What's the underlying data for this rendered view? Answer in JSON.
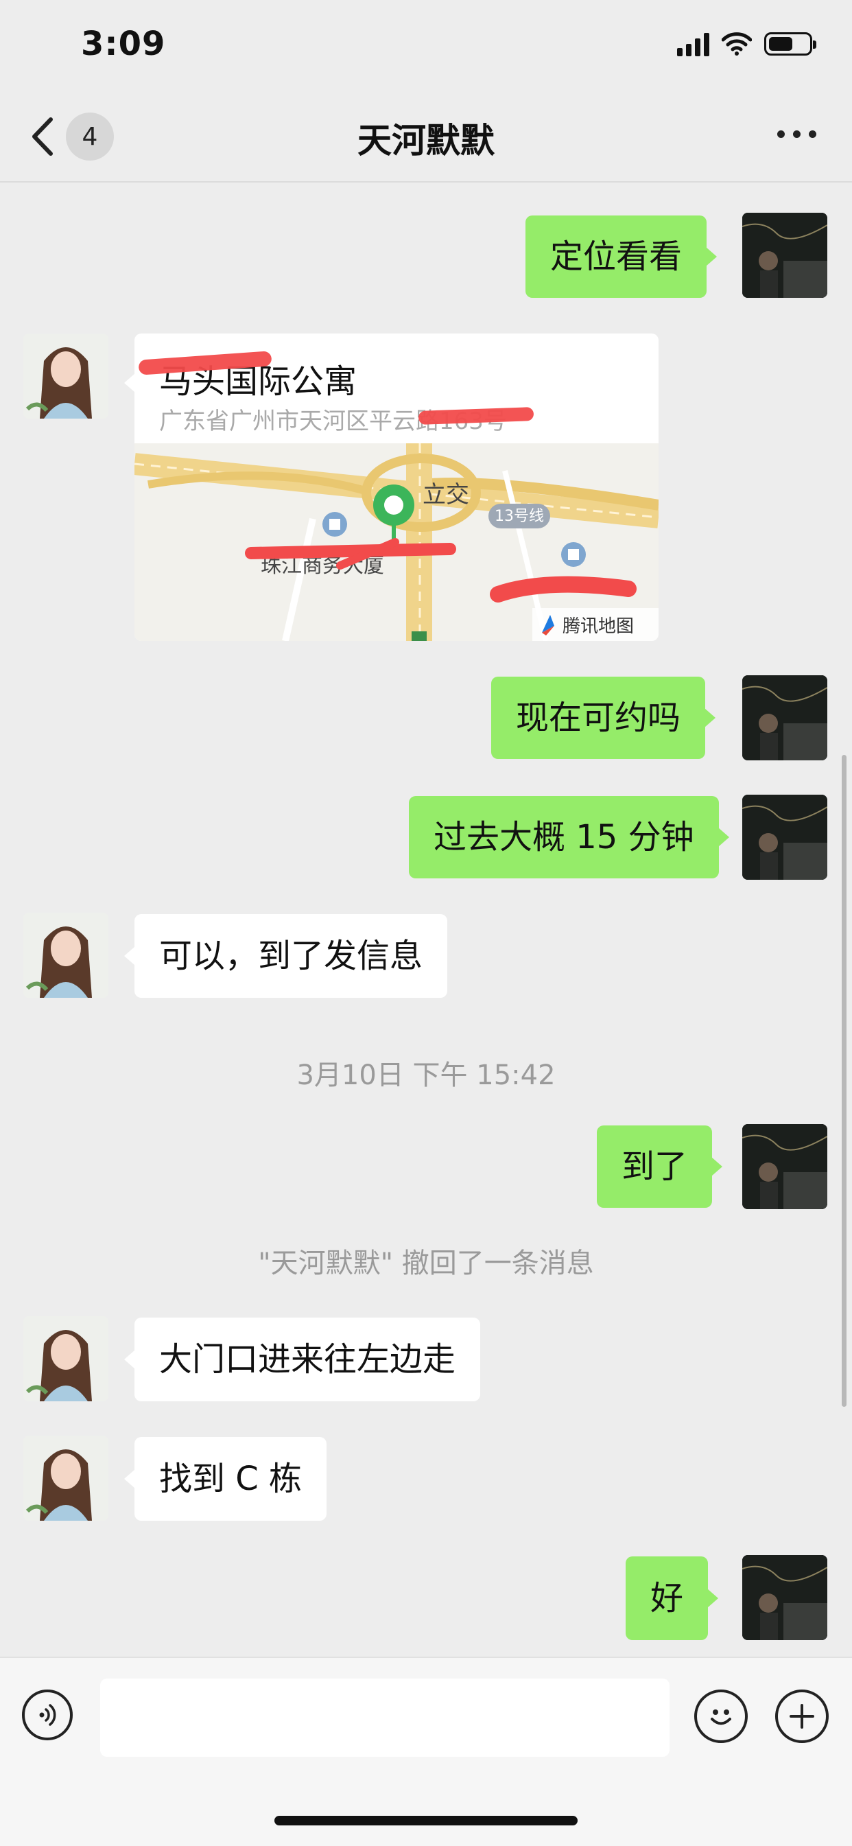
{
  "status_bar": {
    "time": "3:09"
  },
  "header": {
    "back_badge": "4",
    "title": "天河默默"
  },
  "messages": [
    {
      "side": "right",
      "text": "定位看看"
    },
    {
      "side": "left",
      "type": "location",
      "name": "马头国际公寓",
      "address": "广东省广州市天河区平云路163号",
      "map_labels": {
        "junction": "立交",
        "metro_line": "13号线",
        "building": "珠江商务大厦",
        "map_brand": "腾讯地图"
      }
    },
    {
      "side": "right",
      "text": "现在可约吗"
    },
    {
      "side": "right",
      "text": "过去大概 15 分钟"
    },
    {
      "side": "left",
      "text": "可以，到了发信息"
    },
    {
      "side": "right",
      "text": "到了"
    },
    {
      "side": "left",
      "text": "大门口进来往左边走"
    },
    {
      "side": "left",
      "text": "找到 C 栋"
    },
    {
      "side": "right",
      "text": "好"
    }
  ],
  "system": {
    "timestamp": "3月10日 下午 15:42",
    "recall_notice": "\"天河默默\" 撤回了一条消息"
  },
  "input": {
    "value": ""
  },
  "colors": {
    "bubble_self": "#95ec69",
    "bubble_other": "#ffffff",
    "background": "#ededed",
    "map_pin": "#3cb55a",
    "redaction": "#f24b4b"
  }
}
